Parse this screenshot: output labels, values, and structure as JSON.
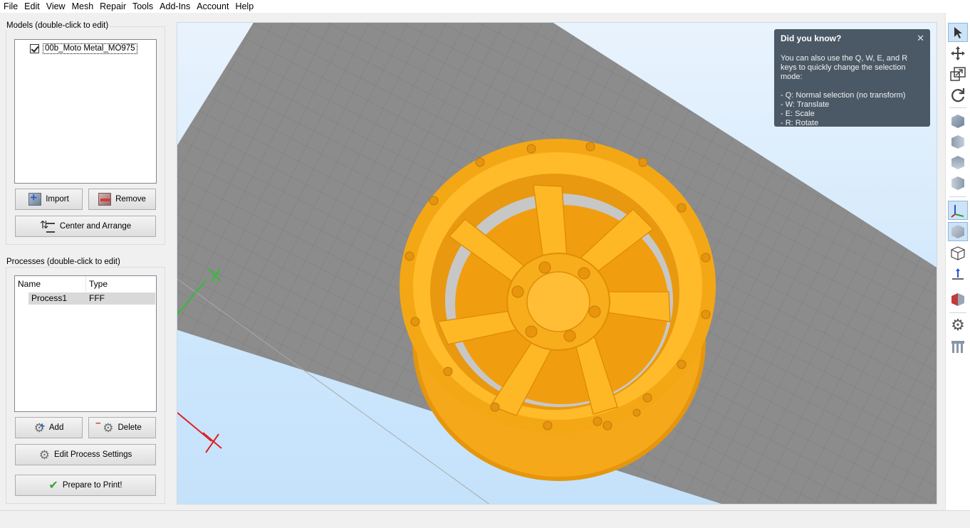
{
  "menu": [
    "File",
    "Edit",
    "View",
    "Mesh",
    "Repair",
    "Tools",
    "Add-Ins",
    "Account",
    "Help"
  ],
  "models": {
    "title": "Models (double-click to edit)",
    "items": [
      {
        "name": "00b_Moto Metal_MO975",
        "checked": true
      }
    ],
    "import_label": "Import",
    "remove_label": "Remove",
    "arrange_label": "Center and Arrange"
  },
  "processes": {
    "title": "Processes (double-click to edit)",
    "columns": [
      "Name",
      "Type"
    ],
    "rows": [
      {
        "name": "Process1",
        "type": "FFF"
      }
    ],
    "add_label": "Add",
    "delete_label": "Delete",
    "edit_label": "Edit Process Settings",
    "prepare_label": "Prepare to Print!"
  },
  "tip": {
    "title": "Did you know?",
    "close": "✕",
    "body": "You can also use the Q, W, E, and R keys to quickly change the selection mode:\n\n- Q: Normal selection (no transform)\n- W: Translate\n- E: Scale\n- R: Rotate"
  },
  "colors": {
    "model": "#f7ad1c",
    "model_dark": "#e39410",
    "bed": "#8a8a8a",
    "grid_line": "#7a7a7a",
    "axis_x": "#e02020",
    "axis_y": "#30c030",
    "tip_bg": "#4b5966"
  },
  "toolbar_icons": [
    "select-arrow-icon",
    "move-icon",
    "scale-icon",
    "rotate-icon",
    "view-iso-icon",
    "view-front-icon",
    "view-top-icon",
    "view-side-icon",
    "axes-icon",
    "solid-view-icon",
    "wireframe-view-icon",
    "normal-arrow-icon",
    "section-icon",
    "settings-gear-icon",
    "supports-icon"
  ]
}
